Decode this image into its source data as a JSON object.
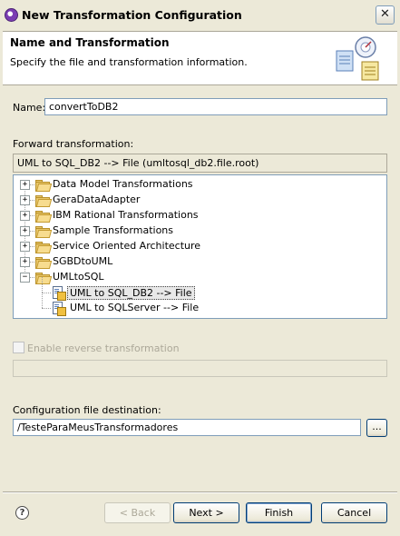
{
  "window": {
    "title": "New Transformation Configuration",
    "close_glyph": "✕",
    "icon": "app-icon"
  },
  "banner": {
    "title": "Name and Transformation",
    "description": "Specify the file and transformation information.",
    "icon": "wizard-banner-icon"
  },
  "name_field": {
    "label": "Name:",
    "value": "convertToDB2"
  },
  "forward": {
    "label": "Forward transformation:",
    "selected_display": "UML to SQL_DB2 --> File (umltosql_db2.file.root)",
    "tree": [
      {
        "label": "Data Model Transformations",
        "expanded": false,
        "type": "folder",
        "level": 0
      },
      {
        "label": "GeraDataAdapter",
        "expanded": false,
        "type": "folder",
        "level": 0
      },
      {
        "label": "IBM Rational Transformations",
        "expanded": false,
        "type": "folder",
        "level": 0
      },
      {
        "label": "Sample Transformations",
        "expanded": false,
        "type": "folder",
        "level": 0
      },
      {
        "label": "Service Oriented Architecture",
        "expanded": false,
        "type": "folder",
        "level": 0
      },
      {
        "label": "SGBDtoUML",
        "expanded": false,
        "type": "folder",
        "level": 0
      },
      {
        "label": "UMLtoSQL",
        "expanded": true,
        "type": "folder",
        "level": 0
      },
      {
        "label": "UML to SQL_DB2 --> File",
        "type": "transformation",
        "level": 1,
        "selected": true
      },
      {
        "label": "UML to SQLServer --> File",
        "type": "transformation",
        "level": 1,
        "selected": false
      }
    ],
    "expand_glyph": "+",
    "collapse_glyph": "−"
  },
  "reverse": {
    "checkbox_label": "Enable reverse transformation",
    "checked": false,
    "enabled": false,
    "value": ""
  },
  "destination": {
    "label": "Configuration file destination:",
    "value": "/TesteParaMeusTransformadores",
    "browse_label": "..."
  },
  "buttons": {
    "help_glyph": "?",
    "back": "< Back",
    "next": "Next >",
    "finish": "Finish",
    "cancel": "Cancel"
  }
}
